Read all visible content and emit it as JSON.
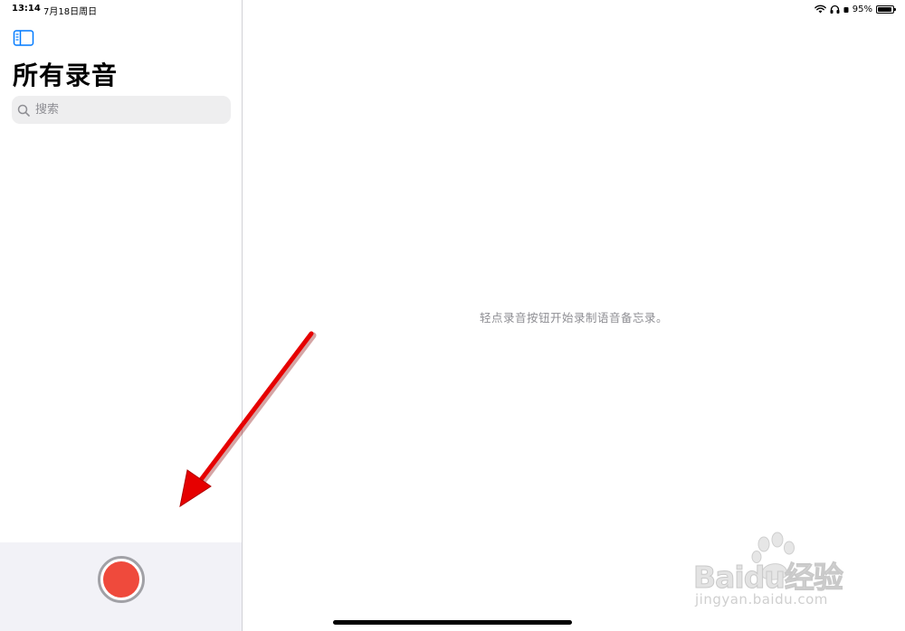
{
  "status_bar": {
    "time": "13:14",
    "date": "7月18日周日",
    "battery_percent": "95%",
    "battery_level": 0.95
  },
  "sidebar": {
    "title": "所有录音",
    "search_placeholder": "搜索",
    "toggle_icon": "sidebar-toggle-icon",
    "record_button_icon": "record-icon"
  },
  "main": {
    "empty_message": "轻点录音按钮开始录制语音备忘录。"
  },
  "watermark": {
    "logo": "Baidu经验",
    "url": "jingyan.baidu.com"
  },
  "colors": {
    "accent": "#007aff",
    "record": "#ef4a3c",
    "sidebar_bottom": "#f2f2f7",
    "search_bg": "#eeeeef",
    "secondary_text": "#8e8e93",
    "annotation": "#e60000"
  }
}
